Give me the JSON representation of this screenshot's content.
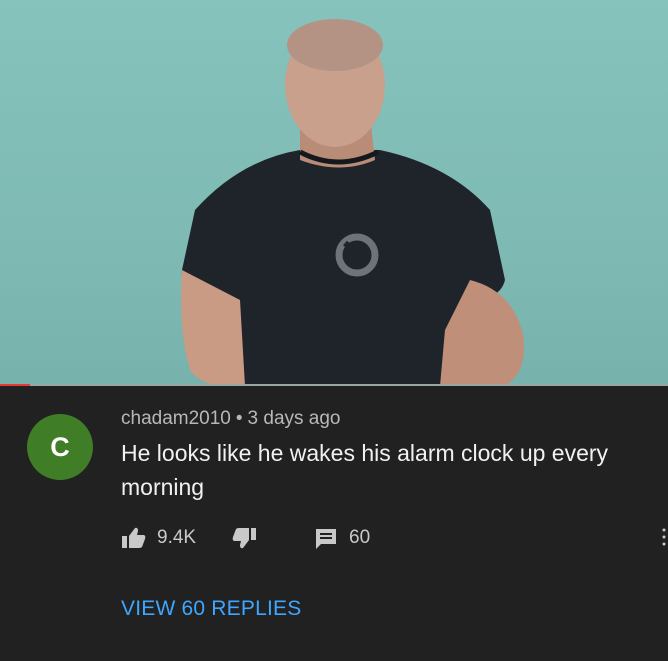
{
  "video": {
    "progress_fraction": 0.045,
    "progress_color": "#e53935",
    "background_color": "#86c3bd",
    "logo_icon": "circle-logo-icon"
  },
  "comment": {
    "avatar_letter": "C",
    "avatar_color": "#3f7d26",
    "author": "chadam2010",
    "separator": "•",
    "time": "3 days ago",
    "text": "He looks like he wakes his alarm clock up every morning",
    "likes": "9.4K",
    "reply_count": "60",
    "like_icon": "thumbs-up-icon",
    "dislike_icon": "thumbs-down-icon",
    "reply_icon": "comment-icon",
    "view_replies_label": "VIEW 60 REPLIES",
    "link_color": "#3ea6ff"
  }
}
